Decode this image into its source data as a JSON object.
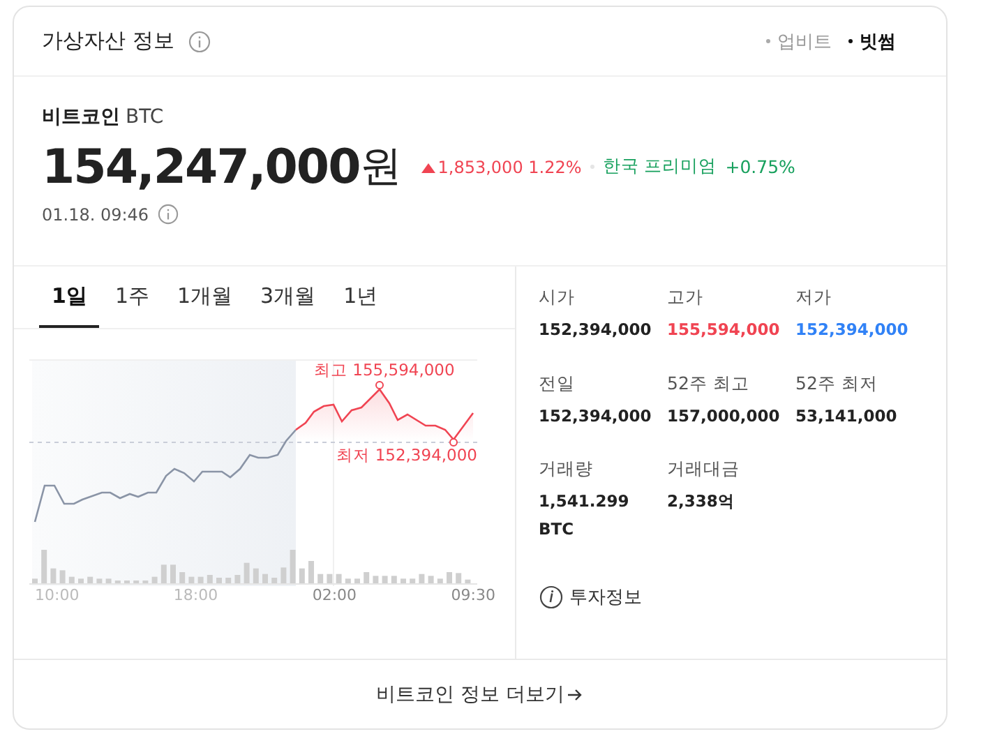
{
  "header": {
    "title": "가상자산 정보",
    "sources": [
      {
        "label": "업비트",
        "selected": false
      },
      {
        "label": "빗썸",
        "selected": true
      }
    ]
  },
  "coin": {
    "name": "비트코인",
    "symbol": "BTC",
    "price": "154,247,000",
    "unit": "원",
    "change": "1,853,000 1.22%",
    "rising": true,
    "premium_label": "한국 프리미엄",
    "premium_value": "+0.75%",
    "time": "01.18. 09:46"
  },
  "tabs": [
    {
      "label": "1일",
      "selected": true
    },
    {
      "label": "1주",
      "selected": false
    },
    {
      "label": "1개월",
      "selected": false
    },
    {
      "label": "3개월",
      "selected": false
    },
    {
      "label": "1년",
      "selected": false
    }
  ],
  "chart": {
    "high_label": "최고 155,594,000",
    "low_label": "최저 152,394,000",
    "x_labels": [
      "10:00",
      "18:00",
      "02:00",
      "09:30"
    ]
  },
  "stats": [
    {
      "label": "시가",
      "value": "152,394,000",
      "kind": "plain"
    },
    {
      "label": "고가",
      "value": "155,594,000",
      "kind": "up"
    },
    {
      "label": "저가",
      "value": "152,394,000",
      "kind": "down"
    },
    {
      "label": "전일",
      "value": "152,394,000",
      "kind": "plain"
    },
    {
      "label": "52주 최고",
      "value": "157,000,000",
      "kind": "plain"
    },
    {
      "label": "52주 최저",
      "value": "53,141,000",
      "kind": "plain"
    },
    {
      "label": "거래량",
      "value": "1,541.299 BTC",
      "kind": "plain"
    },
    {
      "label": "거래대금",
      "value": "2,338억",
      "kind": "plain"
    }
  ],
  "invest_info": "투자정보",
  "more_link": "비트코인 정보 더보기"
}
